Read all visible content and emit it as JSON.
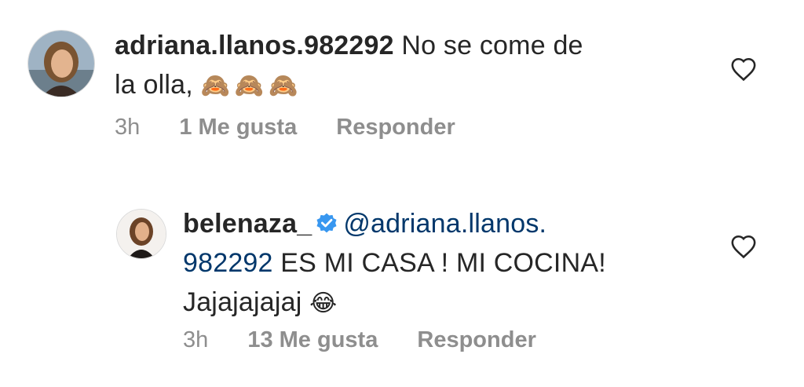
{
  "comments": [
    {
      "username": "adriana.llanos.982292",
      "text_line1": " No se come de",
      "text_line2": "la olla,",
      "emoji": "🙈🙈🙈",
      "time": "3h",
      "likes": "1 Me gusta",
      "reply": "Responder",
      "icon": "heart-icon"
    },
    {
      "username": "belenaza_",
      "verified": true,
      "mention_part1": "@adriana.llanos.",
      "mention_part2": "982292",
      "text_line2": " ES MI CASA ! MI COCINA!",
      "text_line3": "Jajajajajaj",
      "emoji": "😂",
      "time": "3h",
      "likes": "13 Me gusta",
      "reply": "Responder",
      "icon": "heart-icon"
    }
  ],
  "colors": {
    "text": "#262626",
    "meta": "#8e8e8e",
    "mention": "#00376b",
    "verified": "#3897f0"
  }
}
